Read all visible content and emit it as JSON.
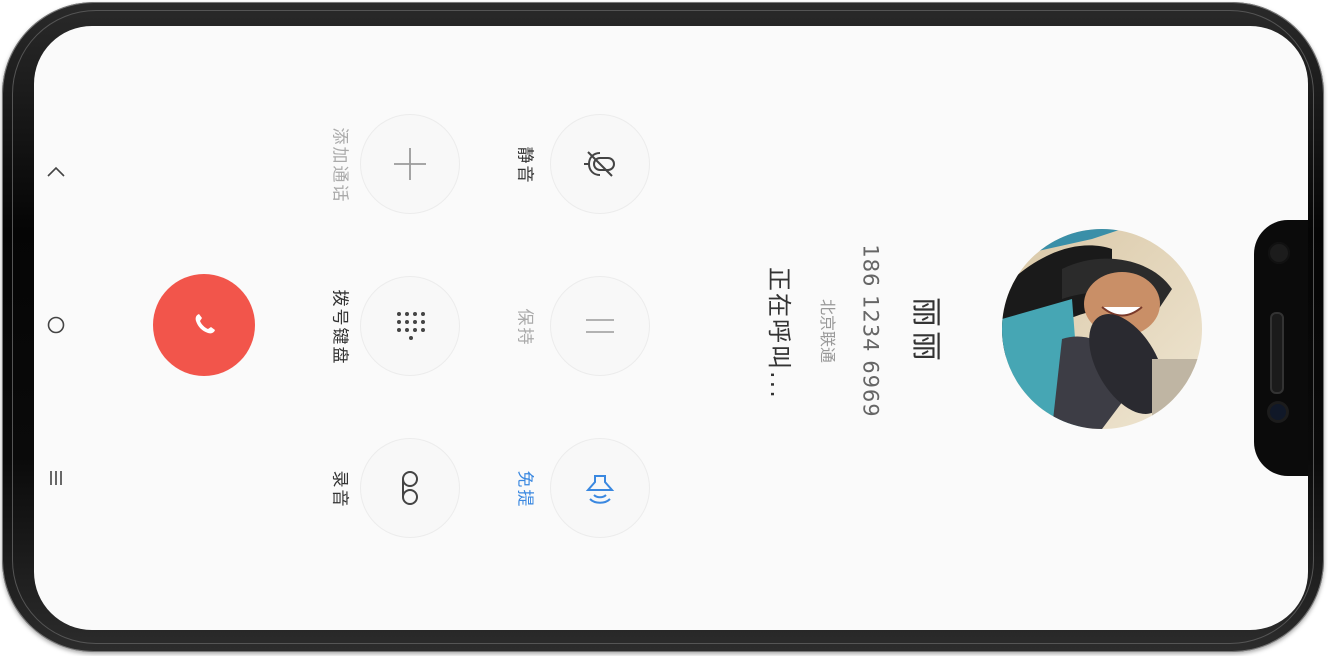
{
  "caller": {
    "name": "丽丽",
    "number": "186 1234 6969",
    "carrier": "北京联通",
    "status": "正在呼叫..."
  },
  "controls": {
    "mute_label": "静音",
    "add_call_label": "添加通话",
    "hold_label": "保持",
    "keypad_label": "拨号键盘",
    "speaker_label": "免提",
    "record_label": "录音"
  },
  "nav": {
    "back_glyph": "^",
    "home_glyph": "○",
    "menu_glyph": "≡"
  },
  "colors": {
    "end_call": "#f2554b",
    "active_blue": "#3a88e0",
    "screen_bg": "#fafafa"
  },
  "icons": {
    "mute": "mic-off-icon",
    "add_call": "plus-icon",
    "hold": "pause-icon",
    "keypad": "dialpad-icon",
    "speaker": "speaker-icon",
    "record": "record-icon",
    "end_call": "phone-hangup-icon"
  }
}
